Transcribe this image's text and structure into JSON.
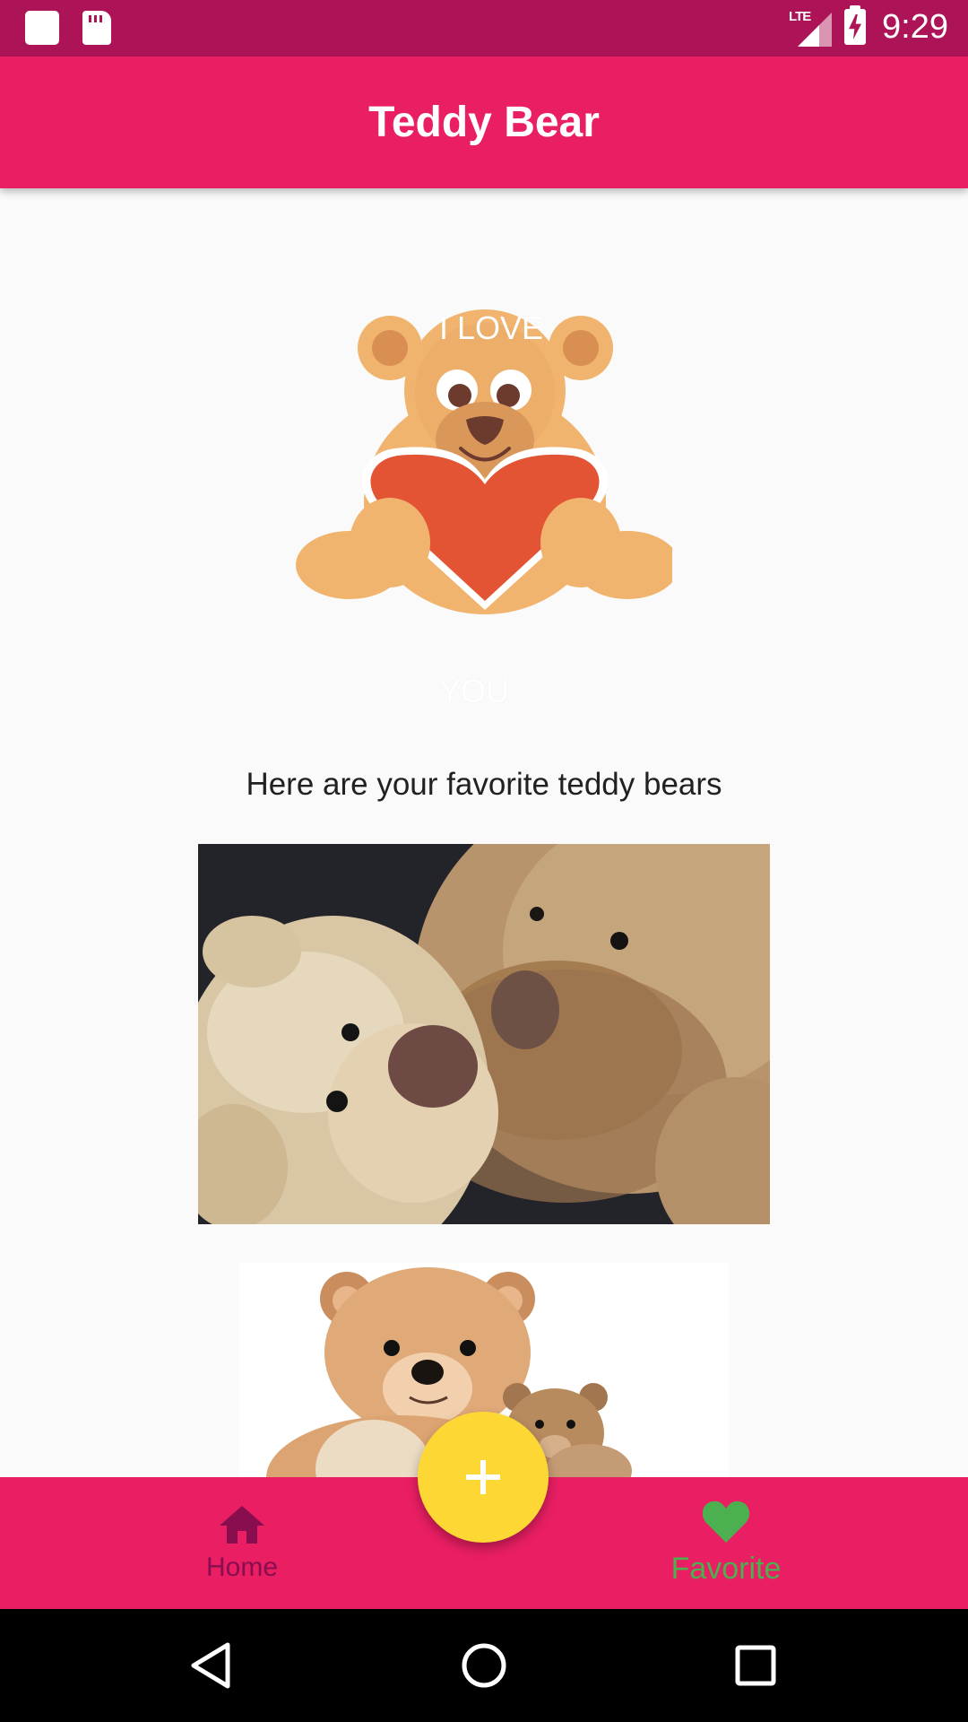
{
  "status_bar": {
    "time": "9:29",
    "network": "LTE",
    "icons": [
      "notification-square-icon",
      "sd-card-icon",
      "signal-icon",
      "battery-charging-icon"
    ]
  },
  "app_bar": {
    "title": "Teddy Bear"
  },
  "hero": {
    "icon": "teddy-bear-heart-illustration",
    "love_text": "I LOVE",
    "you_text": "YOU"
  },
  "content": {
    "subtitle": "Here are your favorite teddy bears",
    "photos": [
      {
        "name": "two-teddy-bears-photo"
      },
      {
        "name": "teddy-bear-family-photo"
      }
    ]
  },
  "bottom_nav": {
    "items": [
      {
        "label": "Home",
        "icon": "home-icon"
      },
      {
        "label": "Favorite",
        "icon": "heart-icon"
      }
    ],
    "fab_icon": "plus-icon"
  },
  "colors": {
    "status_bar": "#ad1457",
    "primary": "#e91e63",
    "fab": "#fdd835",
    "nav_active": "#4caf50",
    "nav_inactive": "#880e4f"
  }
}
